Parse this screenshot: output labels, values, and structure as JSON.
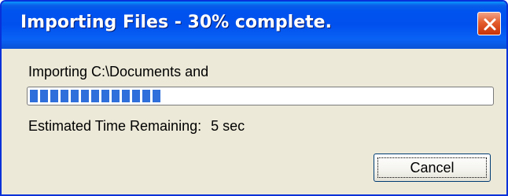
{
  "window": {
    "title": "Importing Files - 30% complete.",
    "close_icon": "close-icon"
  },
  "message": "Importing C:\\Documents and",
  "progress": {
    "fraction": 0.3,
    "color": "#2f6fdc"
  },
  "eta": {
    "label": "Estimated Time Remaining:",
    "value": "5 sec"
  },
  "buttons": {
    "cancel": "Cancel"
  },
  "colors": {
    "titlebar": "#0050ee",
    "dialog_bg": "#ece9d8",
    "close_button": "#e45d2d"
  }
}
